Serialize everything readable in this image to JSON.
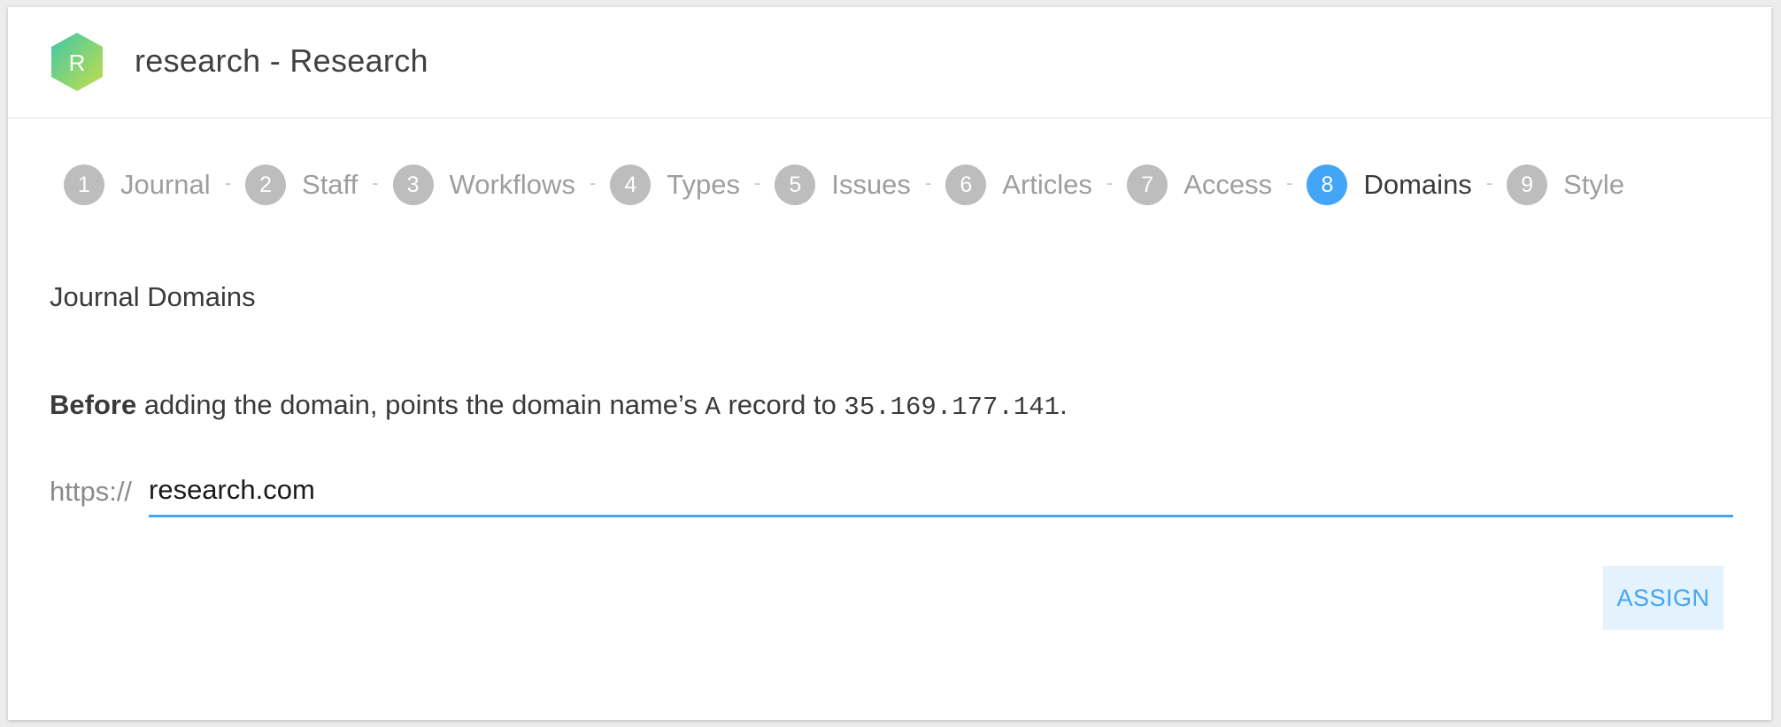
{
  "header": {
    "logo_letter": "R",
    "title": "research - Research"
  },
  "stepper": {
    "separator": "-",
    "steps": [
      {
        "number": "1",
        "label": "Journal"
      },
      {
        "number": "2",
        "label": "Staff"
      },
      {
        "number": "3",
        "label": "Workflows"
      },
      {
        "number": "4",
        "label": "Types"
      },
      {
        "number": "5",
        "label": "Issues"
      },
      {
        "number": "6",
        "label": "Articles"
      },
      {
        "number": "7",
        "label": "Access"
      },
      {
        "number": "8",
        "label": "Domains"
      },
      {
        "number": "9",
        "label": "Style"
      }
    ],
    "active_step": "8"
  },
  "section": {
    "title": "Journal Domains"
  },
  "instruction": {
    "bold": "Before",
    "text1": " adding the domain, points the domain name’s ",
    "record": "A",
    "text2": " record to ",
    "ip": "35.169.177.141",
    "text3": "."
  },
  "domain_form": {
    "prefix": "https://",
    "value": "research.com",
    "assign_label": "ASSIGN"
  },
  "colors": {
    "accent": "#42a5f5",
    "inactive_step": "#bdbdbd",
    "button_bg": "#e3f2fd"
  }
}
